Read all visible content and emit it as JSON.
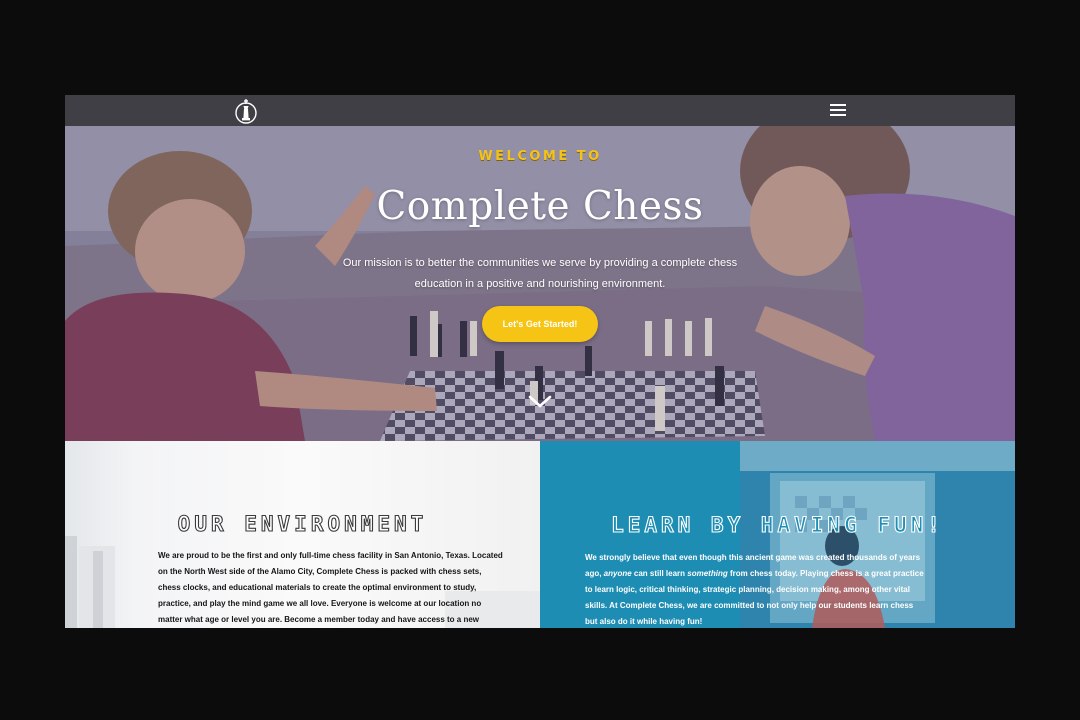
{
  "header": {
    "logo_icon": "chess-king-shield-logo",
    "menu_icon": "hamburger-menu-icon"
  },
  "hero": {
    "eyebrow": "WELCOME TO",
    "title": "Complete Chess",
    "mission": "Our mission is to better the communities we serve by providing a complete chess education in a positive and nourishing environment.",
    "cta_label": "Let's Get Started!",
    "scroll_icon": "chevron-down-icon",
    "accent_color": "#f6c415"
  },
  "environment": {
    "heading": "OUR ENVIRONMENT",
    "text": "We are proud to be the first and only full-time chess facility in San Antonio, Texas. Located on the North West side of the Alamo City,  Complete Chess is packed with chess sets, chess clocks, and educational materials to create the optimal environment to study, practice, and play the mind game we all love. Everyone is welcome at our location no matter what age or level you are. Become a member today and have access to a new"
  },
  "learn": {
    "heading": "LEARN BY HAVING FUN!",
    "text_parts": {
      "p1": "We ",
      "strong": "strongly",
      "p2": " believe that even though this ancient game was created thousands of years ago, ",
      "em1": "anyone",
      "p3": " can still learn ",
      "em2": "something",
      "p4": " from chess today. Playing chess is a great practice to learn logic, critical thinking, strategic planning, decision making, among other vital skills.  At Complete Chess, we are committed to not only help our students learn chess but also do it while having fun!"
    },
    "bg_color": "#1f8fb5"
  }
}
